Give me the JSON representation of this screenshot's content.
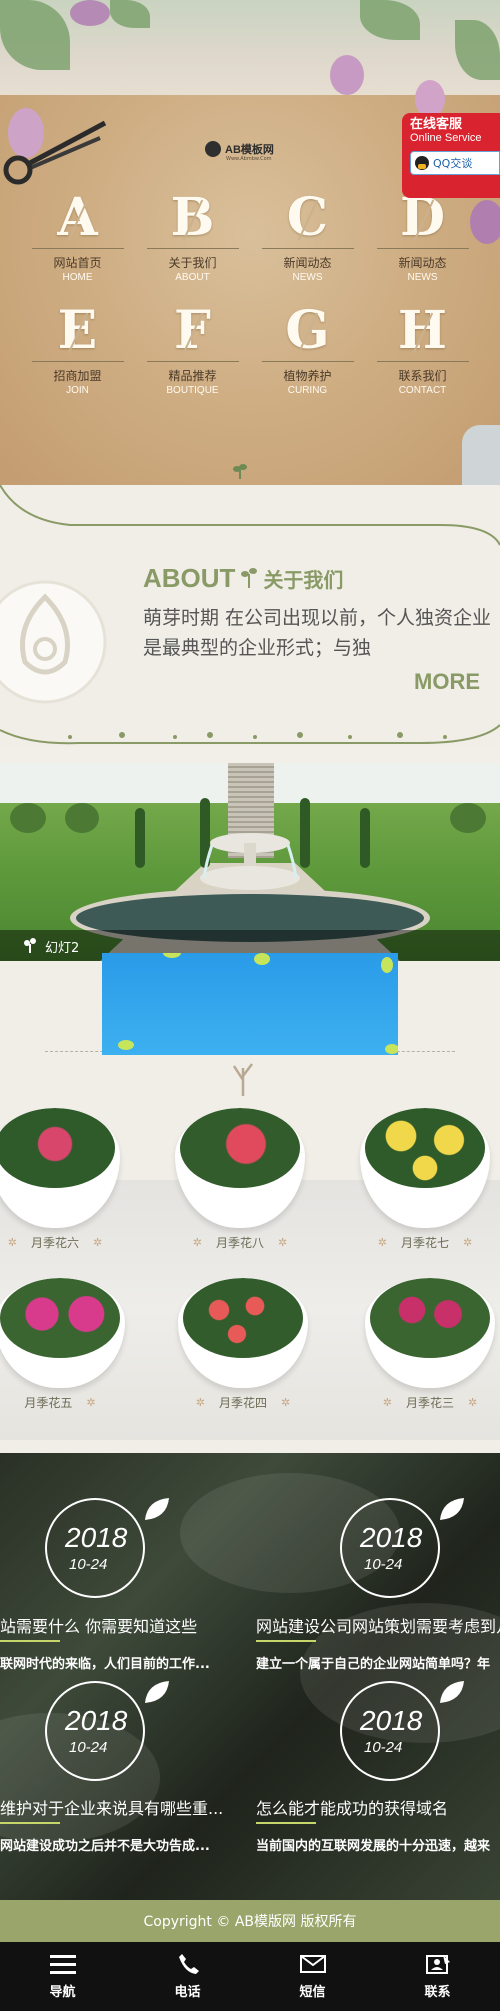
{
  "hero": {
    "logo_text": "AB模板网",
    "logo_sub": "Www.Abmbw.Com",
    "nav": [
      {
        "letter": "A",
        "cn": "网站首页",
        "en": "HOME"
      },
      {
        "letter": "B",
        "cn": "关于我们",
        "en": "ABOUT"
      },
      {
        "letter": "C",
        "cn": "新闻动态",
        "en": "NEWS"
      },
      {
        "letter": "D",
        "cn": "新闻动态",
        "en": "NEWS"
      },
      {
        "letter": "E",
        "cn": "招商加盟",
        "en": "JOIN"
      },
      {
        "letter": "F",
        "cn": "精品推荐",
        "en": "BOUTIQUE"
      },
      {
        "letter": "G",
        "cn": "植物养护",
        "en": "CURING"
      },
      {
        "letter": "H",
        "cn": "联系我们",
        "en": "CONTACT"
      }
    ]
  },
  "online_service": {
    "title_cn": "在线客服",
    "title_en": "Online Service",
    "qq_label": "QQ交谈"
  },
  "about": {
    "title_en": "ABOUT",
    "title_cn": "关于我们",
    "text": "萌芽时期 在公司出现以前，个人独资企业是最典型的企业形式；与独",
    "more": "MORE"
  },
  "slider": {
    "caption": "幻灯2"
  },
  "products": [
    {
      "name": "月季花六",
      "color": "#d8466c"
    },
    {
      "name": "月季花八",
      "color": "#e04a5c"
    },
    {
      "name": "月季花七",
      "color": "#f0d84a"
    },
    {
      "name": "月季花五",
      "color": "#d83a8c"
    },
    {
      "name": "月季花四",
      "color": "#e85a58"
    },
    {
      "name": "月季花三",
      "color": "#c8306a"
    }
  ],
  "news": [
    {
      "year": "2018",
      "md": "10-24",
      "title": "站需要什么 你需要知道这些",
      "desc": "联网时代的来临，人们目前的工作..."
    },
    {
      "year": "2018",
      "md": "10-24",
      "title": "网站建设公司网站策划需要考虑到几",
      "desc": "建立一个属于自己的企业网站简单吗？年"
    },
    {
      "year": "2018",
      "md": "10-24",
      "title": "维护对于企业来说具有哪些重...",
      "desc": "网站建设成功之后并不是大功告成..."
    },
    {
      "year": "2018",
      "md": "10-24",
      "title": "怎么能才能成功的获得域名",
      "desc": "当前国内的互联网发展的十分迅速，越来"
    }
  ],
  "footer": {
    "copyright": "Copyright © AB模版网 版权所有"
  },
  "bottom_nav": [
    {
      "label": "导航",
      "icon": "menu-icon"
    },
    {
      "label": "电话",
      "icon": "phone-icon"
    },
    {
      "label": "短信",
      "icon": "envelope-icon"
    },
    {
      "label": "联系",
      "icon": "contact-card-icon"
    }
  ]
}
